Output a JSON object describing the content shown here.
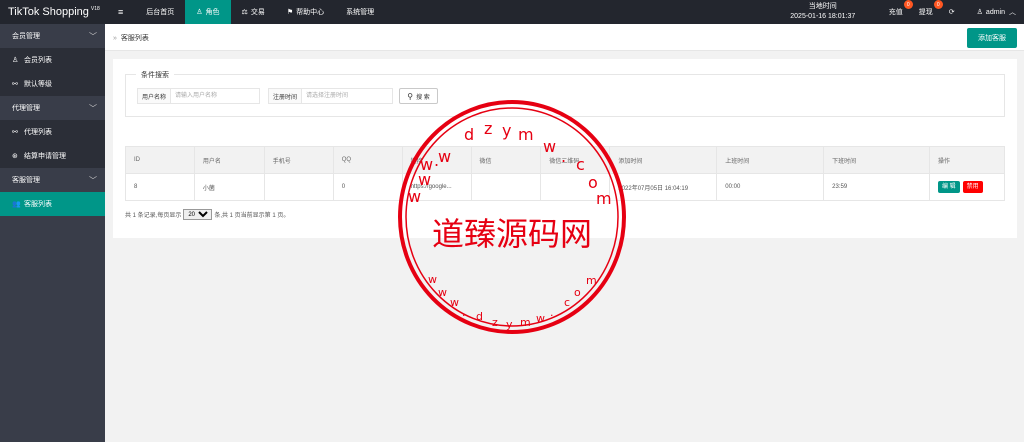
{
  "app": {
    "brand": "TikTok Shopping",
    "version": "V18"
  },
  "topnav": [
    {
      "icon": "≡",
      "label": ""
    },
    {
      "icon": "",
      "label": "后台首页"
    },
    {
      "icon": "♙",
      "label": "角色"
    },
    {
      "icon": "⚖",
      "label": "交易"
    },
    {
      "icon": "⚑",
      "label": "帮助中心"
    },
    {
      "icon": "",
      "label": "系统管理"
    }
  ],
  "header_right": {
    "clock_label": "当地时间",
    "clock_value": "2025-01-16 18:01:37",
    "recharge": "充值",
    "recharge_count": "0",
    "withdraw": "提现",
    "withdraw_count": "0",
    "refresh_icon": "⟳",
    "user": "admin"
  },
  "sidebar": {
    "groups": [
      {
        "label": "会员管理",
        "items": [
          {
            "icon": "♙",
            "label": "会员列表"
          },
          {
            "icon": "⚯",
            "label": "默认等级"
          }
        ]
      },
      {
        "label": "代理管理",
        "items": [
          {
            "icon": "⚯",
            "label": "代理列表"
          },
          {
            "icon": "⊛",
            "label": "结算申请管理"
          }
        ]
      },
      {
        "label": "客服管理",
        "items": [
          {
            "icon": "👥",
            "label": "客服列表"
          }
        ]
      }
    ]
  },
  "breadcrumb": {
    "sep": "»",
    "current": "客服列表"
  },
  "toolbar": {
    "add_label": "添加客服"
  },
  "search": {
    "legend": "条件搜索",
    "username_label": "用户名称",
    "username_placeholder": "请输入用户名称",
    "regtime_label": "注册时间",
    "regtime_placeholder": "请选择注册时间",
    "search_label": "搜 索"
  },
  "table": {
    "headers": [
      "ID",
      "用户名",
      "手机号",
      "QQ",
      "链接",
      "微信",
      "微信二维码",
      "添加时间",
      "上班时间",
      "下班时间",
      "操作"
    ],
    "rows": [
      {
        "id": "8",
        "username": "小菌",
        "phone": "",
        "qq": "0",
        "link": "https://google...",
        "wechat": "",
        "qr": "",
        "added": "2022年07月05日 16:04:19",
        "start": "00:00",
        "end": "23:59",
        "edit": "编 辑",
        "disable": "禁用"
      }
    ]
  },
  "pager": {
    "prefix": "共 1 条记录,每页显示",
    "page_size": "20",
    "suffix": "条,共 1 页当前显示第 1 页。"
  },
  "stamp": {
    "center_text": "道臻源码网",
    "color": "#e60012"
  }
}
